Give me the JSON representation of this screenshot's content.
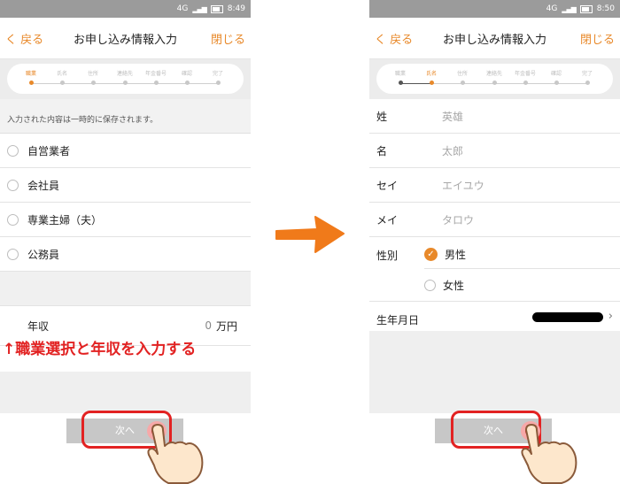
{
  "left": {
    "status": {
      "network": "4G",
      "time": "8:49"
    },
    "nav": {
      "back": "く 戻る",
      "title": "お申し込み情報入力",
      "close": "閉じる"
    },
    "steps": [
      "職業",
      "氏名",
      "住所",
      "連絡先",
      "年金番号",
      "確認",
      "完了"
    ],
    "active_step": 0,
    "note": "入力された内容は一時的に保存されます。",
    "options": [
      "自営業者",
      "会社員",
      "専業主婦（夫）",
      "公務員"
    ],
    "income": {
      "label": "年収",
      "value": "0",
      "unit": "万円"
    },
    "annotation": "↑職業選択と年収を入力する",
    "next": "次へ"
  },
  "right": {
    "status": {
      "network": "4G",
      "time": "8:50"
    },
    "nav": {
      "back": "く 戻る",
      "title": "お申し込み情報入力",
      "close": "閉じる"
    },
    "steps": [
      "職業",
      "氏名",
      "住所",
      "連絡先",
      "年金番号",
      "確認",
      "完了"
    ],
    "active_step": 1,
    "fields": [
      {
        "label": "姓",
        "placeholder": "英雄"
      },
      {
        "label": "名",
        "placeholder": "太郎"
      },
      {
        "label": "セイ",
        "placeholder": "エイユウ"
      },
      {
        "label": "メイ",
        "placeholder": "タロウ"
      }
    ],
    "gender": {
      "label": "性別",
      "options": [
        "男性",
        "女性"
      ],
      "selected": 0
    },
    "birth": {
      "label": "生年月日"
    },
    "next": "次へ"
  },
  "colors": {
    "accent": "#e8892a",
    "annotation": "#e22222",
    "status_bar": "#9b9b9b"
  }
}
